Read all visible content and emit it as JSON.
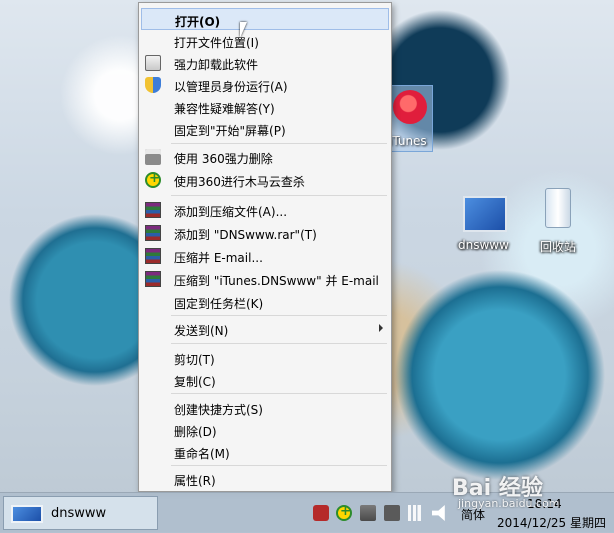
{
  "context_menu": {
    "items": [
      {
        "label": "打开(O)",
        "icon": "none",
        "highlighted": true
      },
      {
        "label": "打开文件位置(I)",
        "icon": "none"
      },
      {
        "label": "强力卸载此软件",
        "icon": "trash-icon"
      },
      {
        "label": "以管理员身份运行(A)",
        "icon": "uac-shield-icon"
      },
      {
        "label": "兼容性疑难解答(Y)",
        "icon": "none"
      },
      {
        "label": "固定到\"开始\"屏幕(P)",
        "icon": "none"
      },
      {
        "label": "使用 360强力删除",
        "icon": "shredder-icon"
      },
      {
        "label": "使用360进行木马云查杀",
        "icon": "360-icon"
      },
      {
        "label": "添加到压缩文件(A)...",
        "icon": "winrar-icon"
      },
      {
        "label": "添加到 \"DNSwww.rar\"(T)",
        "icon": "winrar-icon"
      },
      {
        "label": "压缩并 E-mail...",
        "icon": "winrar-icon"
      },
      {
        "label": "压缩到 \"iTunes.DNSwww\" 并 E-mail",
        "icon": "winrar-icon"
      },
      {
        "label": "固定到任务栏(K)",
        "icon": "none"
      },
      {
        "label": "发送到(N)",
        "icon": "none",
        "submenu": true
      },
      {
        "label": "剪切(T)",
        "icon": "none"
      },
      {
        "label": "复制(C)",
        "icon": "none"
      },
      {
        "label": "创建快捷方式(S)",
        "icon": "none"
      },
      {
        "label": "删除(D)",
        "icon": "none"
      },
      {
        "label": "重命名(M)",
        "icon": "none"
      },
      {
        "label": "属性(R)",
        "icon": "none"
      }
    ]
  },
  "desktop": {
    "itunes_label": "iTunes",
    "dnswww_label": "dnswww",
    "recycle_bin_label": "回收站"
  },
  "taskbar": {
    "task_label": "dnswww",
    "ime_label": "简体",
    "time": "18:14",
    "date": "2014/12/25 星期四"
  },
  "watermark": {
    "main": "Bai 经验",
    "sub": "jingyan.baidu.com"
  },
  "colors": {
    "menu_bg": "#f5f5f5",
    "highlight": "#dbe8f8"
  }
}
